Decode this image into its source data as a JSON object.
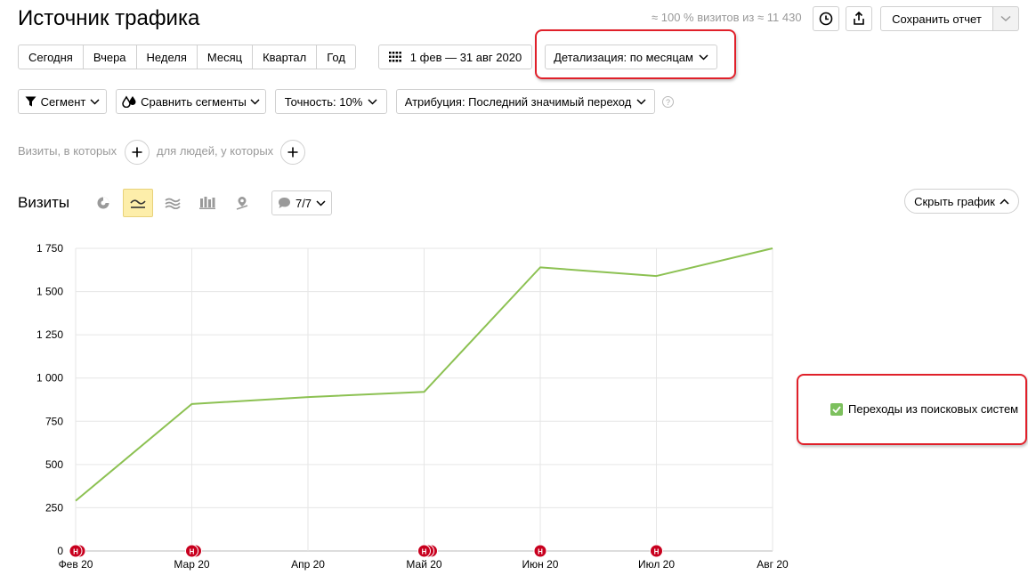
{
  "header": {
    "title": "Источник трафика",
    "visits_summary": "≈ 100 % визитов из ≈ 11 430",
    "save_report": "Сохранить отчет"
  },
  "periods": [
    "Сегодня",
    "Вчера",
    "Неделя",
    "Месяц",
    "Квартал",
    "Год"
  ],
  "date_range": "1 фев — 31 авг 2020",
  "detail": "Детализация: по месяцам",
  "filters": {
    "segment": "Сегмент",
    "compare": "Сравнить сегменты",
    "accuracy": "Точность: 10%",
    "attribution": "Атрибуция: Последний значимый переход"
  },
  "conditions": {
    "visits_where": "Визиты, в которых",
    "people_where": "для людей, у которых"
  },
  "chart_section": {
    "title": "Визиты",
    "annotations_count": "7/7",
    "hide_chart": "Скрыть график"
  },
  "colors": {
    "accent_line": "#8cc152",
    "highlight": "#e0202a",
    "marker": "#c8001e"
  },
  "chart_data": {
    "type": "line",
    "categories": [
      "Фев 20",
      "Мар 20",
      "Апр 20",
      "Май 20",
      "Июн 20",
      "Июл 20",
      "Авг 20"
    ],
    "yticks": [
      "0",
      "250",
      "500",
      "750",
      "1 000",
      "1 250",
      "1 500",
      "1 750"
    ],
    "ylim": [
      0,
      1750
    ],
    "grid": true,
    "legend_position": "right",
    "series": [
      {
        "name": "Переходы из поисковых систем",
        "color": "#8cc152",
        "values": [
          290,
          850,
          890,
          920,
          1640,
          1590,
          1750
        ]
      }
    ],
    "annotation_markers": [
      {
        "category": "Фев 20",
        "count": 2,
        "label": "Н"
      },
      {
        "category": "Мар 20",
        "count": 2,
        "label": "Н"
      },
      {
        "category": "Май 20",
        "count": 3,
        "label": "Н"
      },
      {
        "category": "Июн 20",
        "count": 1,
        "label": "Н"
      },
      {
        "category": "Июл 20",
        "count": 1,
        "label": "Н"
      }
    ]
  }
}
